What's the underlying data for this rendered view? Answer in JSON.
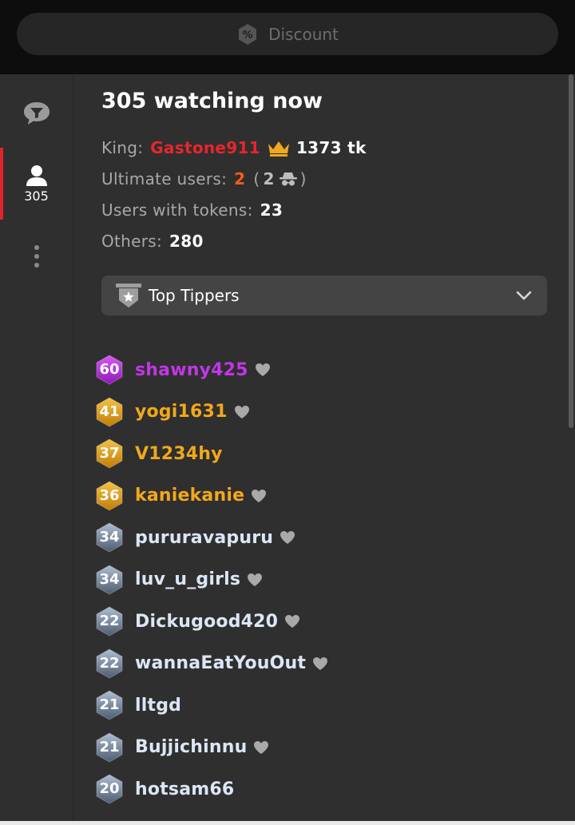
{
  "header": {
    "discount_label": "Discount",
    "discount_icon": "percent-badge-icon"
  },
  "sidebar": {
    "chat_icon": "chat-filter-icon",
    "users_icon": "user-icon",
    "users_count": "305",
    "more_icon": "more-vertical-icon",
    "active_color": "#e0252a"
  },
  "audience": {
    "title": "305 watching now",
    "king_label": "King:",
    "king_name": "Gastone911",
    "king_tokens": "1373 tk",
    "ultimate_label": "Ultimate users:",
    "ultimate_count": "2",
    "ultimate_hidden_open": "(",
    "ultimate_hidden_count": "2",
    "ultimate_hidden_close": ")",
    "tokens_label": "Users with tokens:",
    "tokens_count": "23",
    "others_label": "Others:",
    "others_count": "280"
  },
  "sort": {
    "label": "Top Tippers",
    "icon": "top-tippers-badge-icon",
    "chevron": "chevron-down-icon"
  },
  "users": [
    {
      "level": "60",
      "name": "shawny425",
      "tier": "purple",
      "heart": true
    },
    {
      "level": "41",
      "name": "yogi1631",
      "tier": "gold",
      "heart": true
    },
    {
      "level": "37",
      "name": "V1234hy",
      "tier": "gold",
      "heart": false
    },
    {
      "level": "36",
      "name": "kaniekanie",
      "tier": "gold",
      "heart": true
    },
    {
      "level": "34",
      "name": "pururavapuru",
      "tier": "silver",
      "heart": true
    },
    {
      "level": "34",
      "name": "luv_u_girls",
      "tier": "silver",
      "heart": true
    },
    {
      "level": "22",
      "name": "Dickugood420",
      "tier": "silver",
      "heart": true
    },
    {
      "level": "22",
      "name": "wannaEatYouOut",
      "tier": "silver",
      "heart": true
    },
    {
      "level": "21",
      "name": "lltgd",
      "tier": "silver",
      "heart": false
    },
    {
      "level": "21",
      "name": "Bujjichinnu",
      "tier": "silver",
      "heart": true
    },
    {
      "level": "20",
      "name": "hotsam66",
      "tier": "silver",
      "heart": false
    }
  ],
  "colors": {
    "purple": "#c236e6",
    "gold": "#f2a81c",
    "silver": "#dce6f5",
    "king": "#e8252d",
    "ultimate": "#ff5a1a"
  }
}
